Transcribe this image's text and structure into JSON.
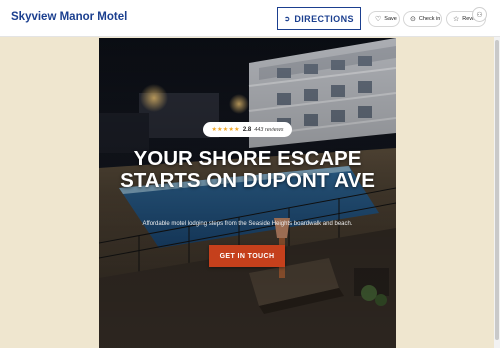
{
  "header": {
    "brand": "Skyview Manor Motel",
    "directions_label": "DIRECTIONS",
    "save_label": "Save",
    "checkin_label": "Check in",
    "review_label": "Revie"
  },
  "hero": {
    "rating_score": "2.8",
    "rating_reviews": "443 reviews",
    "rating_stars": "★★★★★",
    "headline": "YOUR SHORE ESCAPE STARTS ON DUPONT AVE",
    "subline": "Affordable motel lodging steps from the Seaside Heights boardwalk and beach.",
    "cta_label": "GET IN TOUCH"
  },
  "colors": {
    "brand": "#1b3f8f",
    "cta": "#c5401c",
    "page_bg": "#efe6cf"
  }
}
